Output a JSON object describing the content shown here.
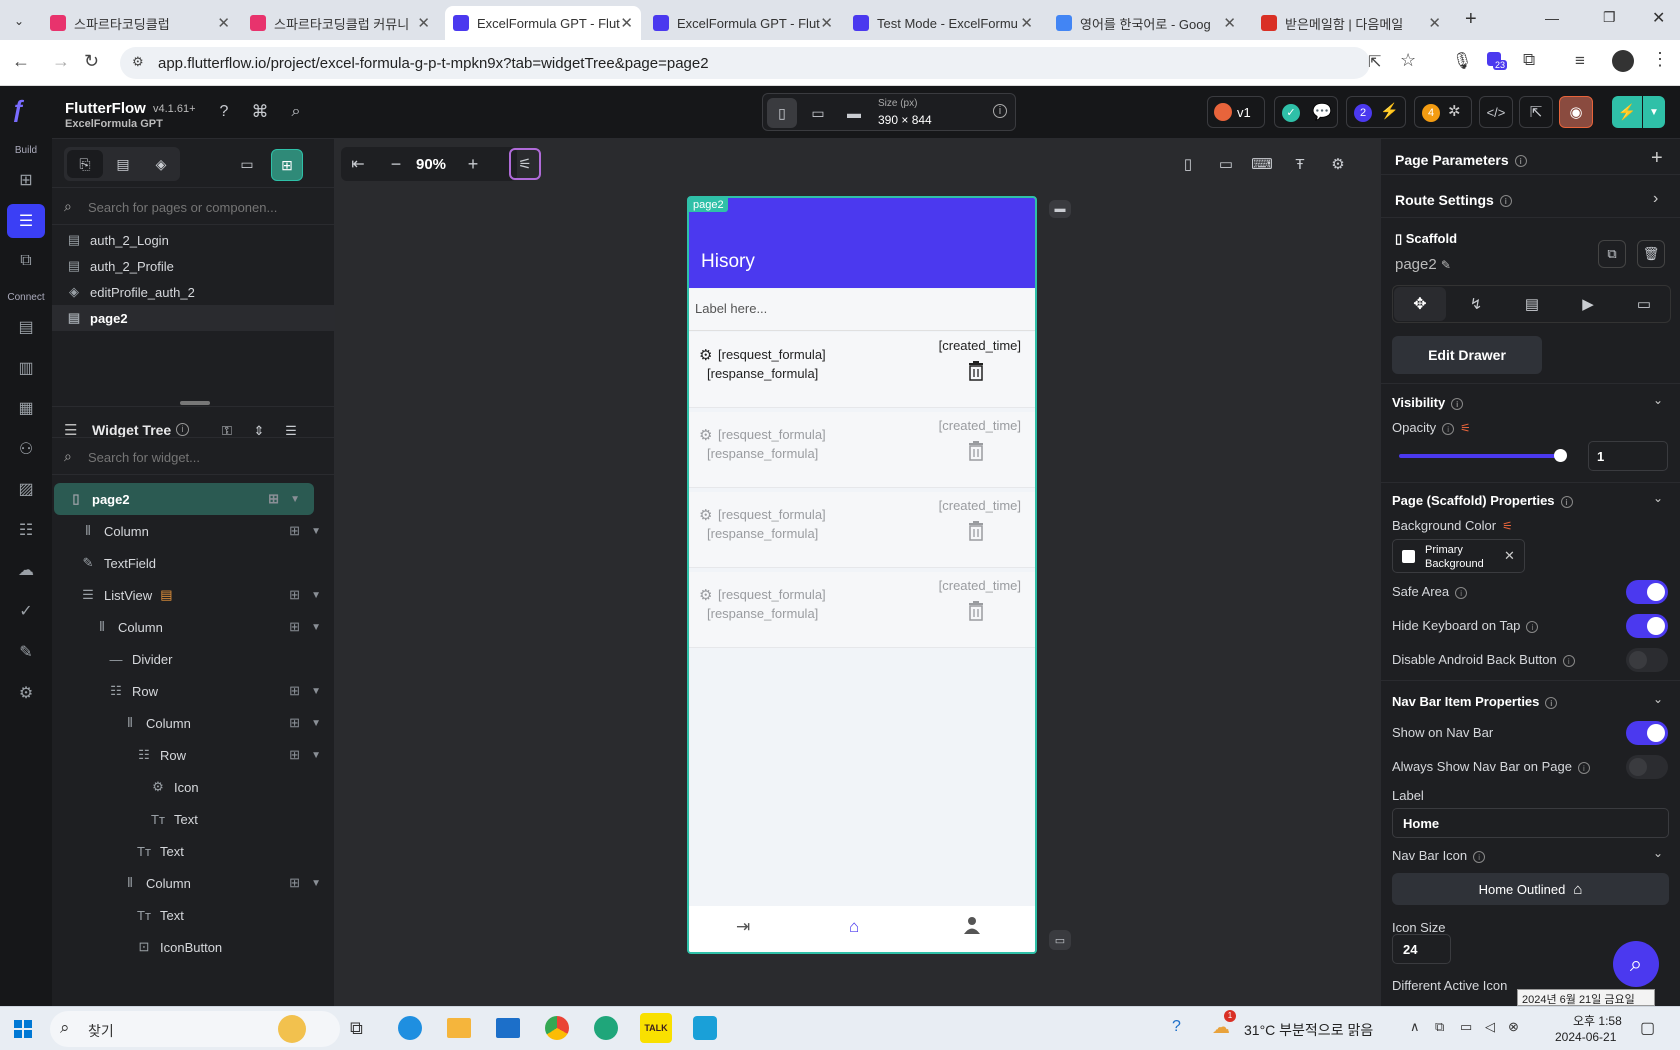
{
  "browser": {
    "tabs": [
      {
        "title": "스파르타코딩클럽",
        "color": "#e8336d",
        "active": false
      },
      {
        "title": "스파르타코딩클럽 커뮤니",
        "color": "#e8336d",
        "active": false
      },
      {
        "title": "ExcelFormula GPT - Flut",
        "color": "#4b39ef",
        "active": true
      },
      {
        "title": "ExcelFormula GPT - Flut",
        "color": "#4b39ef",
        "active": false
      },
      {
        "title": "Test Mode - ExcelFormu",
        "color": "#4b39ef",
        "active": false
      },
      {
        "title": "영어를 한국어로 - Goog",
        "color": "#4285f4",
        "active": false
      },
      {
        "title": "받은메일함 | 다음메일",
        "color": "#d93025",
        "active": false
      }
    ],
    "url": "app.flutterflow.io/project/excel-formula-g-p-t-mpkn9x?tab=widgetTree&page=page2",
    "extension_badge": "23"
  },
  "app": {
    "name": "FlutterFlow",
    "version": "v4.1.61+",
    "project": "ExcelFormula GPT",
    "size_label": "Size (px)",
    "size_value": "390 × 844",
    "version_badge": "v1",
    "badge_2": "2",
    "badge_4": "4",
    "zoom": "90%"
  },
  "rail": {
    "build_label": "Build",
    "connect_label": "Connect"
  },
  "left_panel": {
    "search_pages_placeholder": "Search for pages or componen...",
    "pages": [
      {
        "name": "auth_2_Login",
        "icon": "page-icon",
        "selected": false
      },
      {
        "name": "auth_2_Profile",
        "icon": "page-icon",
        "selected": false
      },
      {
        "name": "editProfile_auth_2",
        "icon": "component-icon",
        "selected": false
      },
      {
        "name": "page2",
        "icon": "page-icon",
        "selected": true
      }
    ],
    "widget_tree_title": "Widget Tree",
    "search_widget_placeholder": "Search for widget...",
    "tree": [
      {
        "name": "page2",
        "depth": 0,
        "icon": "phone-icon",
        "selected": true,
        "addable": true
      },
      {
        "name": "Column",
        "depth": 1,
        "icon": "column-icon",
        "addable": true
      },
      {
        "name": "TextField",
        "depth": 1,
        "icon": "textfield-icon",
        "addable": false
      },
      {
        "name": "ListView",
        "depth": 1,
        "icon": "listview-icon",
        "addable": true
      },
      {
        "name": "Column",
        "depth": 2,
        "icon": "column-icon",
        "addable": true
      },
      {
        "name": "Divider",
        "depth": 3,
        "icon": "divider-icon",
        "addable": false
      },
      {
        "name": "Row",
        "depth": 3,
        "icon": "row-icon",
        "addable": true
      },
      {
        "name": "Column",
        "depth": 4,
        "icon": "column-icon",
        "addable": true
      },
      {
        "name": "Row",
        "depth": 5,
        "icon": "row-icon",
        "addable": true
      },
      {
        "name": "Icon",
        "depth": 6,
        "icon": "gear-icon",
        "addable": false
      },
      {
        "name": "Text",
        "depth": 6,
        "icon": "text-icon",
        "addable": false
      },
      {
        "name": "Text",
        "depth": 5,
        "icon": "text-icon",
        "addable": false
      },
      {
        "name": "Column",
        "depth": 4,
        "icon": "column-icon",
        "addable": true
      },
      {
        "name": "Text",
        "depth": 5,
        "icon": "text-icon",
        "addable": false
      },
      {
        "name": "IconButton",
        "depth": 5,
        "icon": "iconbutton-icon",
        "addable": false
      }
    ]
  },
  "phone": {
    "page_tag": "page2",
    "appbar_title": "Hisory",
    "textfield_placeholder": "Label here...",
    "items": [
      {
        "request": "[resquest_formula]",
        "response": "[respanse_formula]",
        "time": "[created_time]",
        "faded": false
      },
      {
        "request": "[resquest_formula]",
        "response": "[respanse_formula]",
        "time": "[created_time]",
        "faded": true
      },
      {
        "request": "[resquest_formula]",
        "response": "[respanse_formula]",
        "time": "[created_time]",
        "faded": true
      },
      {
        "request": "[resquest_formula]",
        "response": "[respanse_formula]",
        "time": "[created_time]",
        "faded": true
      }
    ]
  },
  "right_panel": {
    "page_parameters": "Page Parameters",
    "route_settings": "Route Settings",
    "widget_type": "Scaffold",
    "widget_name": "page2",
    "edit_drawer": "Edit Drawer",
    "visibility": "Visibility",
    "opacity_label": "Opacity",
    "opacity_value": "1",
    "scaffold_props": "Page (Scaffold) Properties",
    "background_color_label": "Background Color",
    "background_color_value": "Primary Background",
    "safe_area": "Safe Area",
    "safe_area_on": true,
    "hide_keyboard": "Hide Keyboard on Tap",
    "hide_keyboard_on": true,
    "disable_back": "Disable Android Back Button",
    "disable_back_on": false,
    "nav_bar_props": "Nav Bar Item Properties",
    "show_nav": "Show on Nav Bar",
    "show_nav_on": true,
    "always_show_nav": "Always Show Nav Bar on Page",
    "always_show_nav_on": false,
    "label_label": "Label",
    "label_value": "Home",
    "nav_icon_label": "Nav Bar Icon",
    "nav_icon_value": "Home Outlined",
    "icon_size_label": "Icon Size",
    "icon_size_value": "24",
    "different_active_icon": "Different Active Icon",
    "tooltip_date": "2024년 6월 21일 금요일"
  },
  "taskbar": {
    "search_placeholder": "찾기",
    "weather": "31°C  부분적으로 맑음",
    "time": "오후 1:58",
    "date": "2024-06-21",
    "weather_badge": "1"
  },
  "colors": {
    "accent": "#4b39ef",
    "teal": "#2fc0a8",
    "dark_bg": "#1e1f22"
  }
}
